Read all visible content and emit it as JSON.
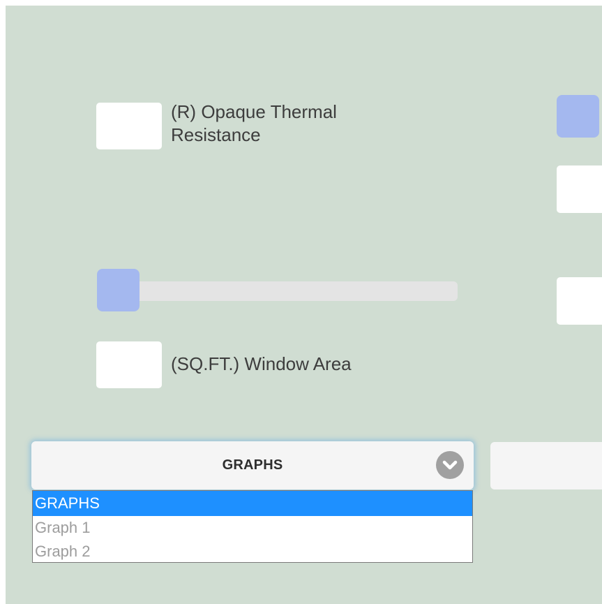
{
  "form": {
    "r_value": "",
    "r_label": "(R) Opaque Thermal Resistance",
    "window_value": "",
    "window_label": "(SQ.FT.) Window Area",
    "slider_level": 0
  },
  "graph_select": {
    "selected": "GRAPHS",
    "options": [
      "GRAPHS",
      "Graph 1",
      "Graph 2"
    ]
  },
  "colors": {
    "panel_bg": "#d0ddd2",
    "slider_knob": "#a4b8ef",
    "option_highlight": "#1e90ff"
  }
}
